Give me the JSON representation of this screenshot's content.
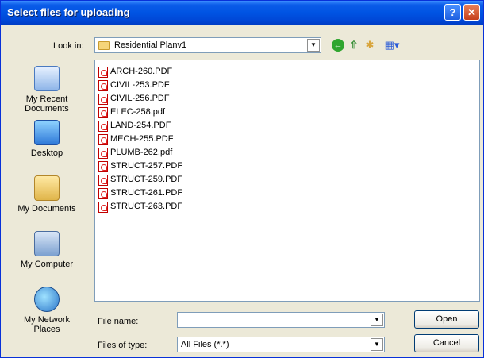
{
  "window": {
    "title": "Select files for uploading",
    "help_label": "?",
    "close_label": "✕"
  },
  "toolbar": {
    "lookin_label": "Look in:",
    "lookin_value": "Residential Planv1",
    "dropdown_glyph": "▼",
    "icons": {
      "back": "back-icon",
      "up": "up-folder-icon",
      "new_folder": "new-folder-icon",
      "view": "view-menu-icon"
    },
    "back_glyph": "←",
    "up_glyph": "⇧",
    "new_folder_glyph": "✱",
    "view_glyph": "▦▾"
  },
  "places": [
    {
      "label_lines": [
        "My Recent",
        "Documents"
      ],
      "icon": "recent-documents-icon"
    },
    {
      "label_lines": [
        "Desktop"
      ],
      "icon": "desktop-icon"
    },
    {
      "label_lines": [
        "My Documents"
      ],
      "icon": "my-documents-icon"
    },
    {
      "label_lines": [
        "My Computer"
      ],
      "icon": "my-computer-icon"
    },
    {
      "label_lines": [
        "My Network",
        "Places"
      ],
      "icon": "network-places-icon"
    }
  ],
  "files": [
    "ARCH-260.PDF",
    "CIVIL-253.PDF",
    "CIVIL-256.PDF",
    "ELEC-258.pdf",
    "LAND-254.PDF",
    "MECH-255.PDF",
    "PLUMB-262.pdf",
    "STRUCT-257.PDF",
    "STRUCT-259.PDF",
    "STRUCT-261.PDF",
    "STRUCT-263.PDF"
  ],
  "form": {
    "file_name_label": "File name:",
    "file_name_value": "",
    "file_type_label": "Files of type:",
    "file_type_value": "All Files (*.*)"
  },
  "buttons": {
    "open": "Open",
    "cancel": "Cancel"
  }
}
